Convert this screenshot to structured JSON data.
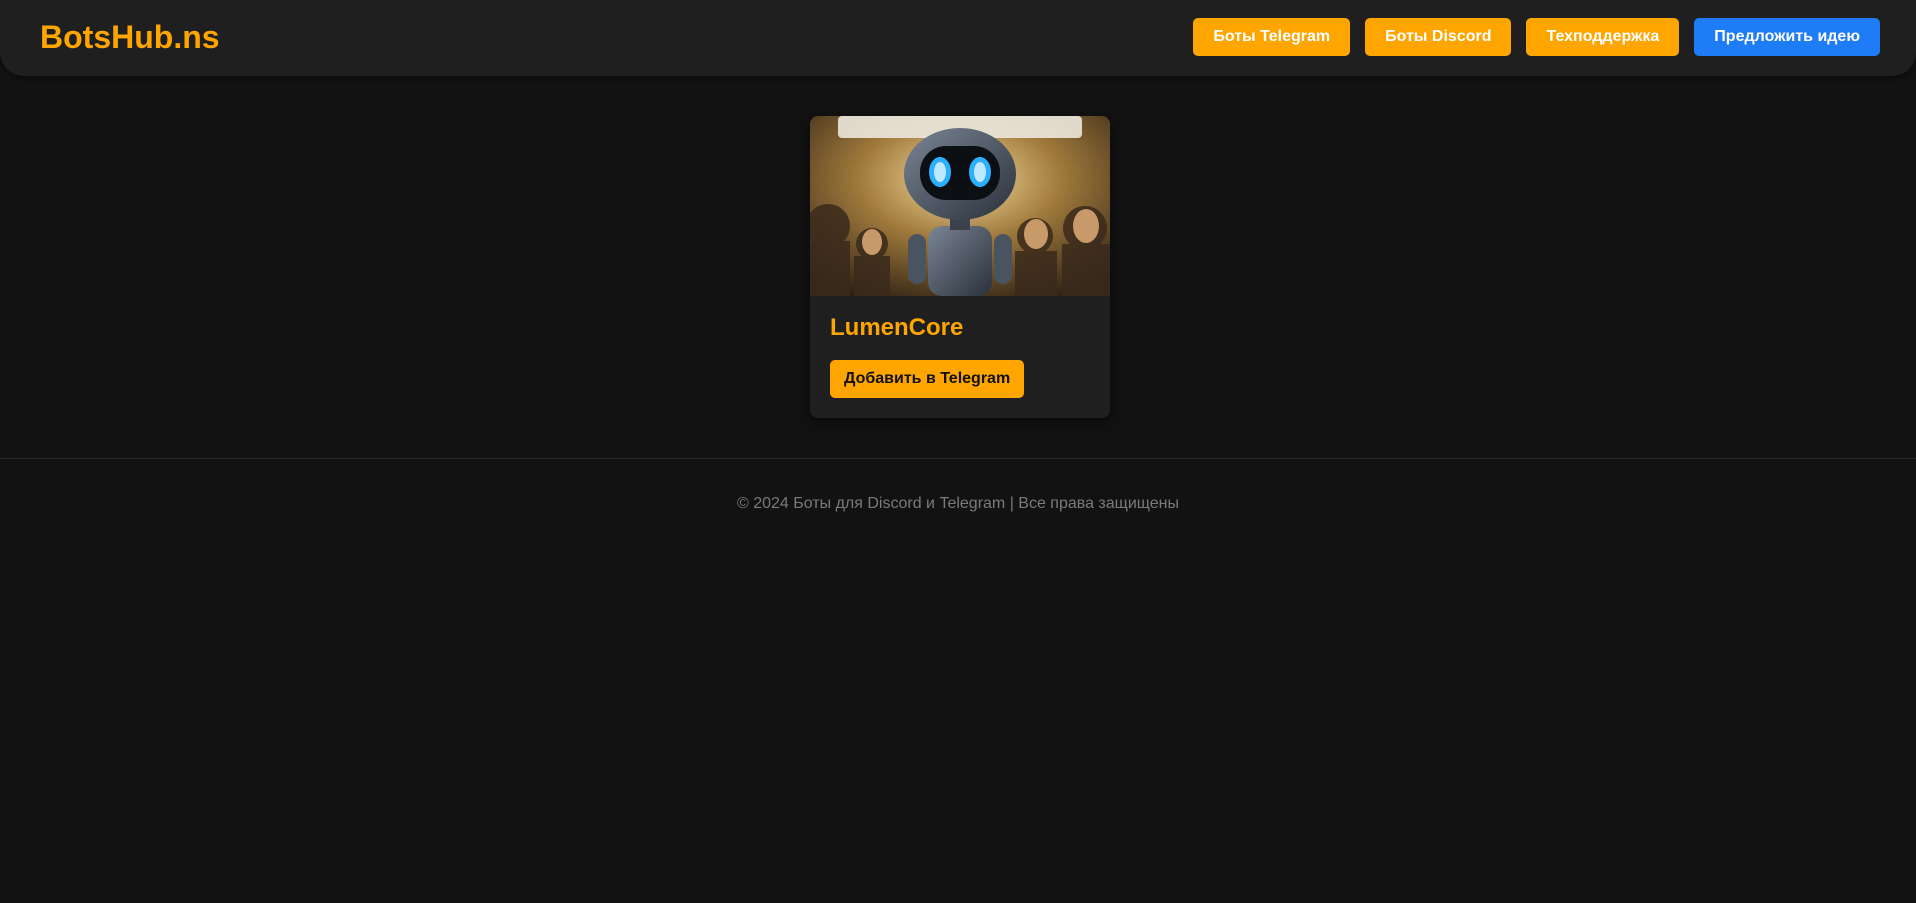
{
  "header": {
    "logo": "BotsHub.ns",
    "nav": [
      {
        "label": "Боты Telegram"
      },
      {
        "label": "Боты Discord"
      },
      {
        "label": "Техподдержка"
      },
      {
        "label": "Предложить идею"
      }
    ]
  },
  "bots": [
    {
      "name": "LumenCore",
      "image_icon": "robot-illustration",
      "add_label": "Добавить в Telegram"
    }
  ],
  "footer": {
    "text": "© 2024 Боты для Discord и Telegram | Все права защищены"
  },
  "colors": {
    "accent": "#ffa500",
    "idea_button": "#1e7cf7",
    "background": "#121212",
    "panel": "#1f1f1f"
  }
}
